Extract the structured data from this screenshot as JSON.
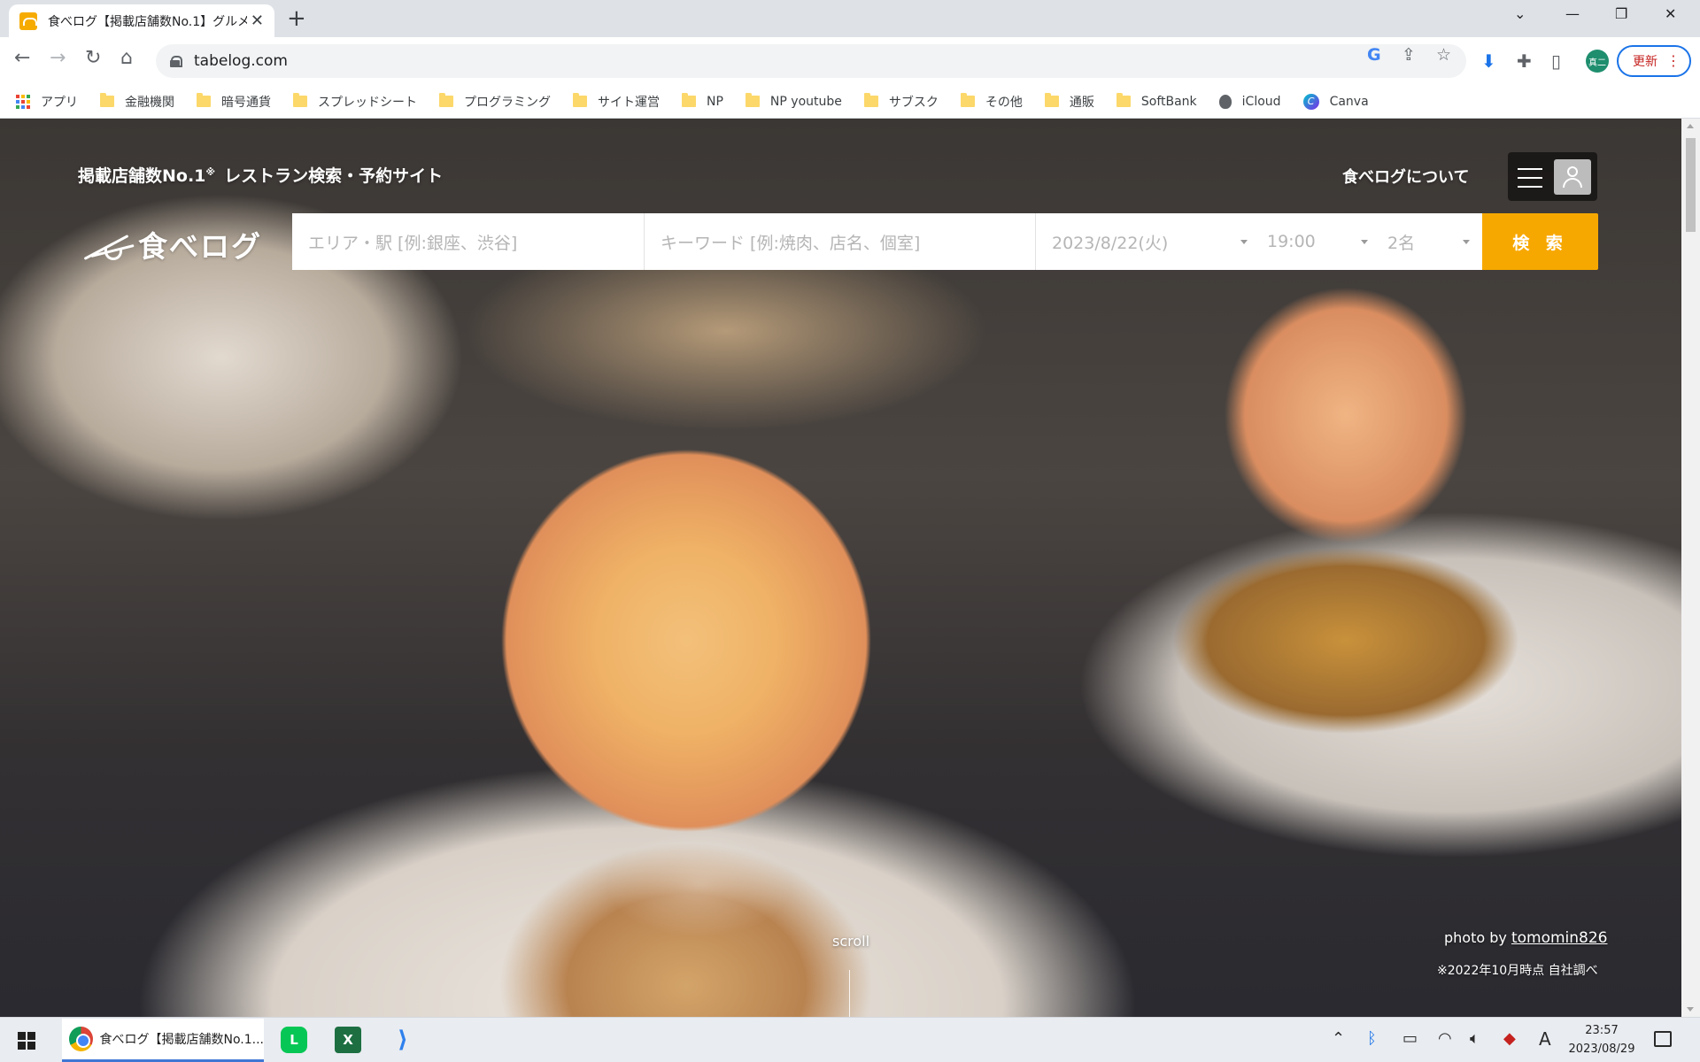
{
  "browser": {
    "tab_title": "食べログ【掲載店舗数No.1】グルメ・",
    "url": "tabelog.com",
    "update_label": "更新",
    "profile_initials": "真二"
  },
  "bookmarks": [
    {
      "label": "アプリ",
      "icon": "apps-icon"
    },
    {
      "label": "金融機関",
      "icon": "folder-icon"
    },
    {
      "label": "暗号通貨",
      "icon": "folder-icon"
    },
    {
      "label": "スプレッドシート",
      "icon": "folder-icon"
    },
    {
      "label": "プログラミング",
      "icon": "folder-icon"
    },
    {
      "label": "サイト運営",
      "icon": "folder-icon"
    },
    {
      "label": "NP",
      "icon": "folder-icon"
    },
    {
      "label": "NP youtube",
      "icon": "folder-icon"
    },
    {
      "label": "サブスク",
      "icon": "folder-icon"
    },
    {
      "label": "その他",
      "icon": "folder-icon"
    },
    {
      "label": "通販",
      "icon": "folder-icon"
    },
    {
      "label": "SoftBank",
      "icon": "folder-icon"
    },
    {
      "label": "iCloud",
      "icon": "apple-icon"
    },
    {
      "label": "Canva",
      "icon": "canva-icon"
    }
  ],
  "header": {
    "tagline": "掲載店舗数No.1",
    "tagline_mark": "※",
    "tagline_rest": "レストラン検索・予約サイト",
    "about_link": "食べログについて",
    "logo_text": "食べログ"
  },
  "search": {
    "area_placeholder": "エリア・駅 [例:銀座、渋谷]",
    "keyword_placeholder": "キーワード [例:焼肉、店名、個室]",
    "date": "2023/8/22(火)",
    "time": "19:00",
    "people": "2名",
    "button_label": "検 索"
  },
  "hero": {
    "scroll_label": "scroll",
    "photo_by": "photo by",
    "photo_author": "tomomin826",
    "footnote": "※2022年10月時点 自社調べ"
  },
  "taskbar": {
    "chrome_label": "食べログ【掲載店舗数No.1...",
    "time": "23:57",
    "date": "2023/08/29",
    "ime": "A"
  },
  "colors": {
    "accent_orange": "#f7a800",
    "chrome_blue": "#1a73e8"
  }
}
